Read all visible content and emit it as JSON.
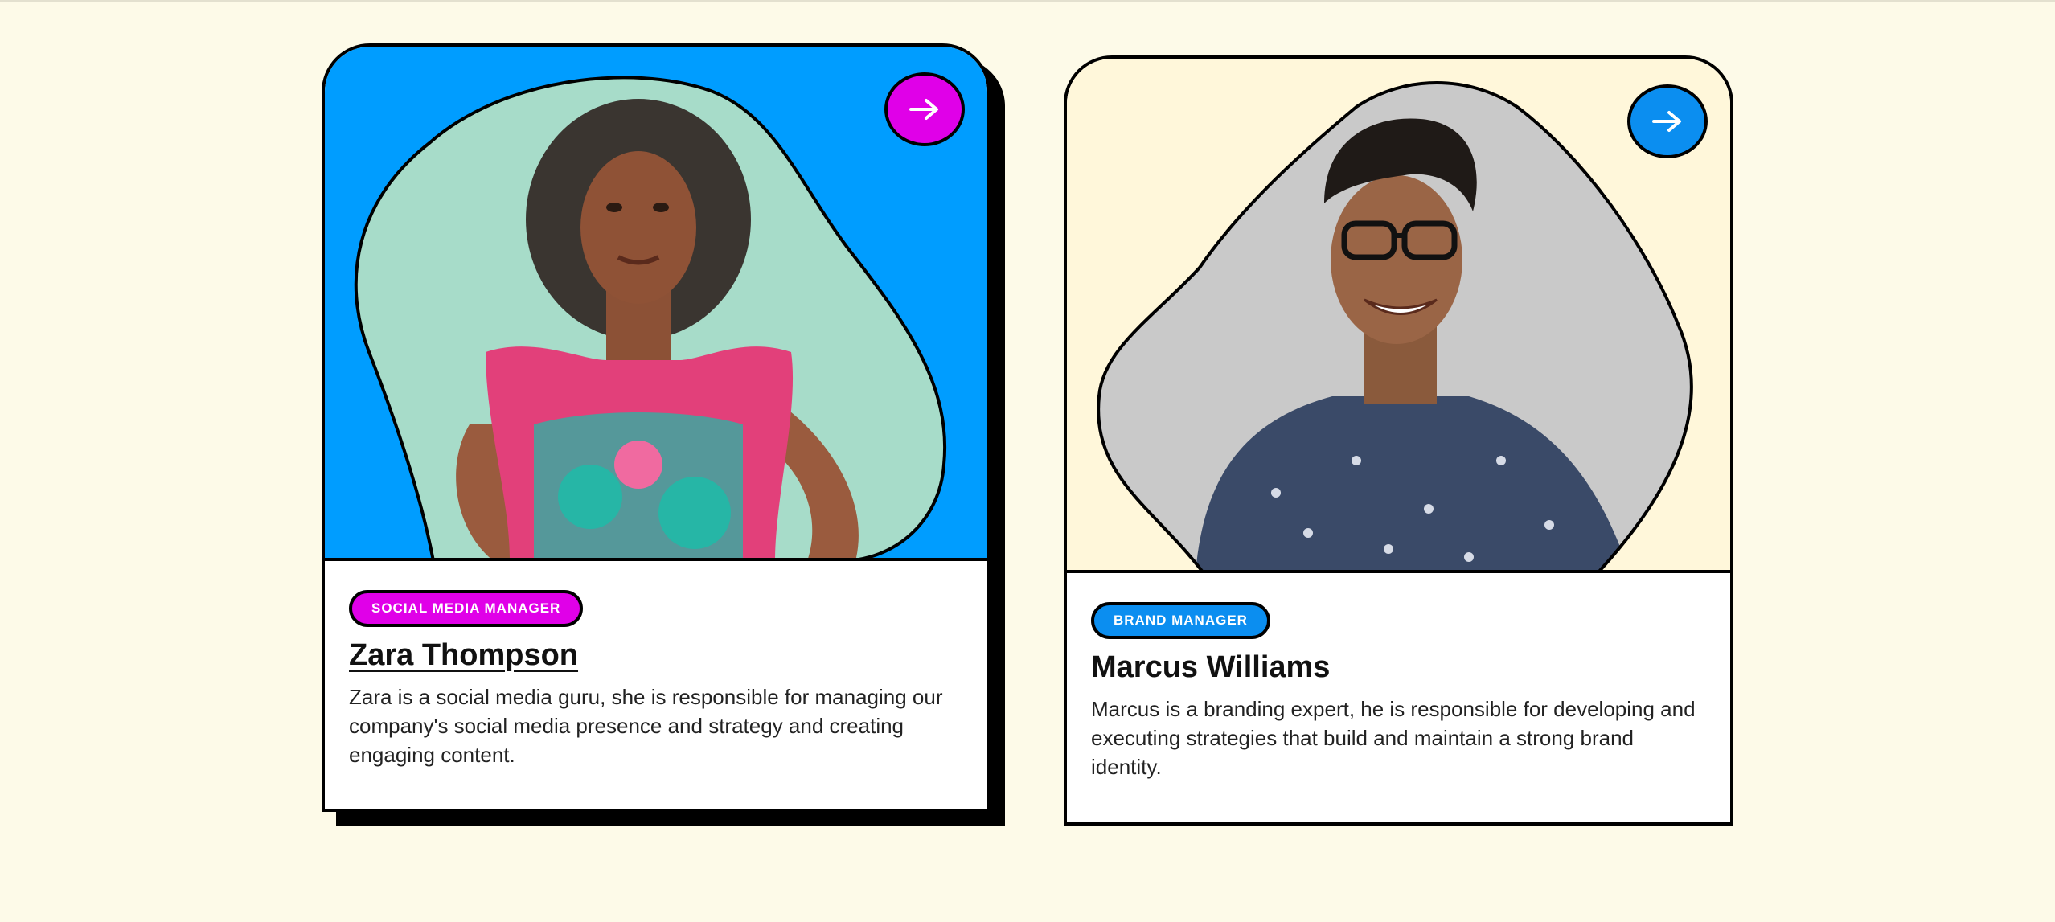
{
  "colors": {
    "page_bg": "#fdfae8",
    "card1_photo_bg": "#009dff",
    "card2_photo_bg": "#fff7da",
    "accent_magenta": "#e000e8",
    "accent_blue": "#0b8ef0"
  },
  "team": [
    {
      "role": "SOCIAL MEDIA MANAGER",
      "name": "Zara Thompson",
      "bio": "Zara is a social media guru, she is responsible for managing our company's social media presence and strategy and creating engaging content.",
      "arrow_icon": "arrow-right-icon"
    },
    {
      "role": "BRAND MANAGER",
      "name": "Marcus Williams",
      "bio": "Marcus is a branding expert, he is responsible for developing and executing strategies that build and maintain a strong brand identity.",
      "arrow_icon": "arrow-right-icon"
    }
  ]
}
